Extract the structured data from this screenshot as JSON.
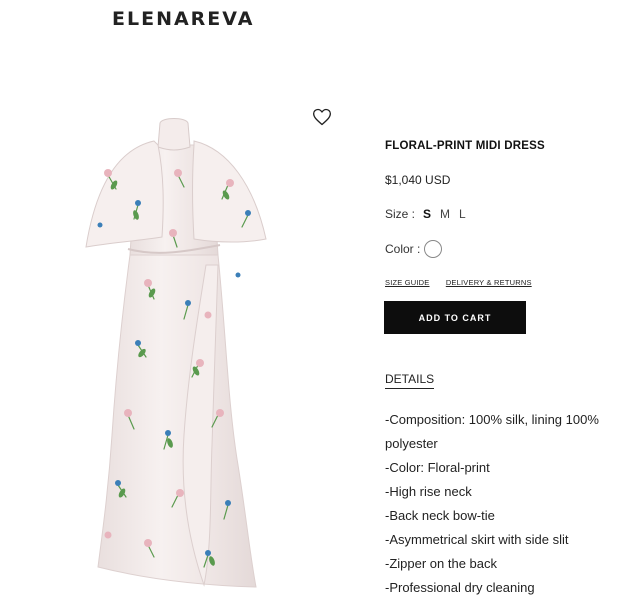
{
  "header": {
    "brand": "ELENAREVA"
  },
  "product": {
    "title": "FLORAL-PRINT MIDI DRESS",
    "price": "$1,040 USD",
    "size_label": "Size :",
    "sizes": [
      "S",
      "M",
      "L"
    ],
    "selected_size": "S",
    "color_label": "Color :",
    "swatch_color": "#ffffff",
    "size_guide": "SIZE GUIDE",
    "delivery_returns": "DELIVERY & RETURNS",
    "add_to_cart": "ADD TO CART",
    "details_heading": "DETAILS",
    "details_lines": [
      "-Composition: 100% silk, lining 100%",
      "polyester",
      "-Color: Floral-print",
      "-High rise neck",
      "-Back neck bow-tie",
      "-Asymmetrical skirt with side slit",
      "-Zipper on the back",
      "-Professional dry cleaning"
    ]
  },
  "colors": {
    "button_bg": "#0d0d0d",
    "dress_base": "#f3ebea",
    "flower_pink": "#e8b4bd",
    "flower_blue": "#3b7fb8",
    "leaf_green": "#5a9a4e"
  },
  "icons": {
    "wishlist": "heart-outline-icon"
  }
}
